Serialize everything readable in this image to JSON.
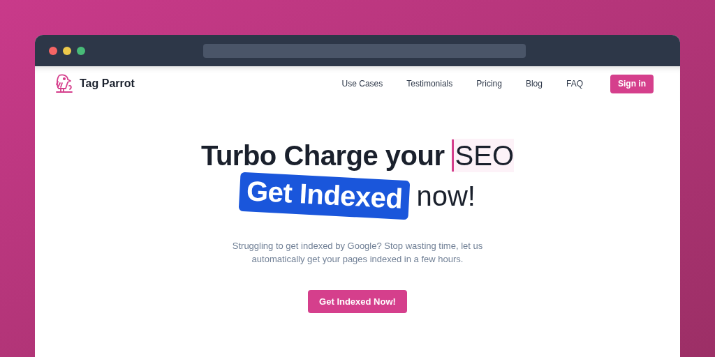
{
  "brand": {
    "name": "Tag Parrot"
  },
  "nav": {
    "links": [
      "Use Cases",
      "Testimonials",
      "Pricing",
      "Blog",
      "FAQ"
    ],
    "sign_in": "Sign in"
  },
  "hero": {
    "headline_bold": "Turbo Charge your",
    "headline_typed": "SEO",
    "highlight": "Get Indexed",
    "headline_end": "now!",
    "subtitle": "Struggling to get indexed by Google? Stop wasting time, let us automatically get your pages indexed in a few hours.",
    "cta": "Get Indexed Now!"
  }
}
